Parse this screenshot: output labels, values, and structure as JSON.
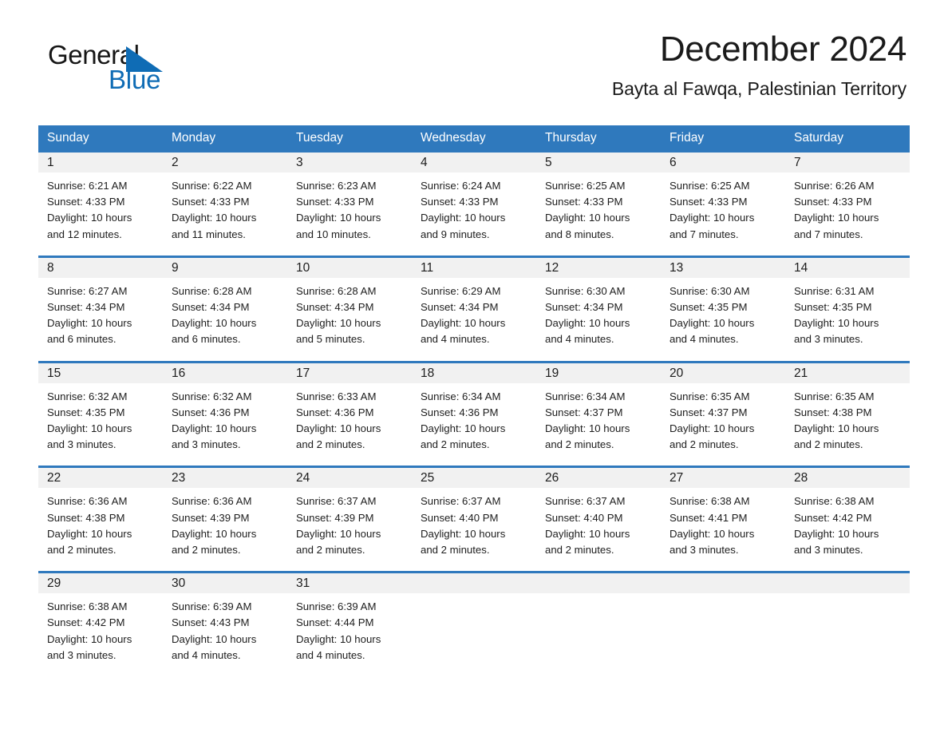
{
  "brand": {
    "name_part1": "General",
    "name_part2": "Blue",
    "logo_icon": "triangle-logo-icon",
    "color_dark": "#161616",
    "color_blue": "#0f6cb5"
  },
  "header": {
    "title": "December 2024",
    "location": "Bayta al Fawqa, Palestinian Territory"
  },
  "calendar": {
    "header_color": "#2f79bd",
    "daynum_band_color": "#f1f1f1",
    "weekdays": [
      "Sunday",
      "Monday",
      "Tuesday",
      "Wednesday",
      "Thursday",
      "Friday",
      "Saturday"
    ],
    "weeks": [
      [
        {
          "day": "1",
          "sunrise": "Sunrise: 6:21 AM",
          "sunset": "Sunset: 4:33 PM",
          "daylight_line1": "Daylight: 10 hours",
          "daylight_line2": "and 12 minutes."
        },
        {
          "day": "2",
          "sunrise": "Sunrise: 6:22 AM",
          "sunset": "Sunset: 4:33 PM",
          "daylight_line1": "Daylight: 10 hours",
          "daylight_line2": "and 11 minutes."
        },
        {
          "day": "3",
          "sunrise": "Sunrise: 6:23 AM",
          "sunset": "Sunset: 4:33 PM",
          "daylight_line1": "Daylight: 10 hours",
          "daylight_line2": "and 10 minutes."
        },
        {
          "day": "4",
          "sunrise": "Sunrise: 6:24 AM",
          "sunset": "Sunset: 4:33 PM",
          "daylight_line1": "Daylight: 10 hours",
          "daylight_line2": "and 9 minutes."
        },
        {
          "day": "5",
          "sunrise": "Sunrise: 6:25 AM",
          "sunset": "Sunset: 4:33 PM",
          "daylight_line1": "Daylight: 10 hours",
          "daylight_line2": "and 8 minutes."
        },
        {
          "day": "6",
          "sunrise": "Sunrise: 6:25 AM",
          "sunset": "Sunset: 4:33 PM",
          "daylight_line1": "Daylight: 10 hours",
          "daylight_line2": "and 7 minutes."
        },
        {
          "day": "7",
          "sunrise": "Sunrise: 6:26 AM",
          "sunset": "Sunset: 4:33 PM",
          "daylight_line1": "Daylight: 10 hours",
          "daylight_line2": "and 7 minutes."
        }
      ],
      [
        {
          "day": "8",
          "sunrise": "Sunrise: 6:27 AM",
          "sunset": "Sunset: 4:34 PM",
          "daylight_line1": "Daylight: 10 hours",
          "daylight_line2": "and 6 minutes."
        },
        {
          "day": "9",
          "sunrise": "Sunrise: 6:28 AM",
          "sunset": "Sunset: 4:34 PM",
          "daylight_line1": "Daylight: 10 hours",
          "daylight_line2": "and 6 minutes."
        },
        {
          "day": "10",
          "sunrise": "Sunrise: 6:28 AM",
          "sunset": "Sunset: 4:34 PM",
          "daylight_line1": "Daylight: 10 hours",
          "daylight_line2": "and 5 minutes."
        },
        {
          "day": "11",
          "sunrise": "Sunrise: 6:29 AM",
          "sunset": "Sunset: 4:34 PM",
          "daylight_line1": "Daylight: 10 hours",
          "daylight_line2": "and 4 minutes."
        },
        {
          "day": "12",
          "sunrise": "Sunrise: 6:30 AM",
          "sunset": "Sunset: 4:34 PM",
          "daylight_line1": "Daylight: 10 hours",
          "daylight_line2": "and 4 minutes."
        },
        {
          "day": "13",
          "sunrise": "Sunrise: 6:30 AM",
          "sunset": "Sunset: 4:35 PM",
          "daylight_line1": "Daylight: 10 hours",
          "daylight_line2": "and 4 minutes."
        },
        {
          "day": "14",
          "sunrise": "Sunrise: 6:31 AM",
          "sunset": "Sunset: 4:35 PM",
          "daylight_line1": "Daylight: 10 hours",
          "daylight_line2": "and 3 minutes."
        }
      ],
      [
        {
          "day": "15",
          "sunrise": "Sunrise: 6:32 AM",
          "sunset": "Sunset: 4:35 PM",
          "daylight_line1": "Daylight: 10 hours",
          "daylight_line2": "and 3 minutes."
        },
        {
          "day": "16",
          "sunrise": "Sunrise: 6:32 AM",
          "sunset": "Sunset: 4:36 PM",
          "daylight_line1": "Daylight: 10 hours",
          "daylight_line2": "and 3 minutes."
        },
        {
          "day": "17",
          "sunrise": "Sunrise: 6:33 AM",
          "sunset": "Sunset: 4:36 PM",
          "daylight_line1": "Daylight: 10 hours",
          "daylight_line2": "and 2 minutes."
        },
        {
          "day": "18",
          "sunrise": "Sunrise: 6:34 AM",
          "sunset": "Sunset: 4:36 PM",
          "daylight_line1": "Daylight: 10 hours",
          "daylight_line2": "and 2 minutes."
        },
        {
          "day": "19",
          "sunrise": "Sunrise: 6:34 AM",
          "sunset": "Sunset: 4:37 PM",
          "daylight_line1": "Daylight: 10 hours",
          "daylight_line2": "and 2 minutes."
        },
        {
          "day": "20",
          "sunrise": "Sunrise: 6:35 AM",
          "sunset": "Sunset: 4:37 PM",
          "daylight_line1": "Daylight: 10 hours",
          "daylight_line2": "and 2 minutes."
        },
        {
          "day": "21",
          "sunrise": "Sunrise: 6:35 AM",
          "sunset": "Sunset: 4:38 PM",
          "daylight_line1": "Daylight: 10 hours",
          "daylight_line2": "and 2 minutes."
        }
      ],
      [
        {
          "day": "22",
          "sunrise": "Sunrise: 6:36 AM",
          "sunset": "Sunset: 4:38 PM",
          "daylight_line1": "Daylight: 10 hours",
          "daylight_line2": "and 2 minutes."
        },
        {
          "day": "23",
          "sunrise": "Sunrise: 6:36 AM",
          "sunset": "Sunset: 4:39 PM",
          "daylight_line1": "Daylight: 10 hours",
          "daylight_line2": "and 2 minutes."
        },
        {
          "day": "24",
          "sunrise": "Sunrise: 6:37 AM",
          "sunset": "Sunset: 4:39 PM",
          "daylight_line1": "Daylight: 10 hours",
          "daylight_line2": "and 2 minutes."
        },
        {
          "day": "25",
          "sunrise": "Sunrise: 6:37 AM",
          "sunset": "Sunset: 4:40 PM",
          "daylight_line1": "Daylight: 10 hours",
          "daylight_line2": "and 2 minutes."
        },
        {
          "day": "26",
          "sunrise": "Sunrise: 6:37 AM",
          "sunset": "Sunset: 4:40 PM",
          "daylight_line1": "Daylight: 10 hours",
          "daylight_line2": "and 2 minutes."
        },
        {
          "day": "27",
          "sunrise": "Sunrise: 6:38 AM",
          "sunset": "Sunset: 4:41 PM",
          "daylight_line1": "Daylight: 10 hours",
          "daylight_line2": "and 3 minutes."
        },
        {
          "day": "28",
          "sunrise": "Sunrise: 6:38 AM",
          "sunset": "Sunset: 4:42 PM",
          "daylight_line1": "Daylight: 10 hours",
          "daylight_line2": "and 3 minutes."
        }
      ],
      [
        {
          "day": "29",
          "sunrise": "Sunrise: 6:38 AM",
          "sunset": "Sunset: 4:42 PM",
          "daylight_line1": "Daylight: 10 hours",
          "daylight_line2": "and 3 minutes."
        },
        {
          "day": "30",
          "sunrise": "Sunrise: 6:39 AM",
          "sunset": "Sunset: 4:43 PM",
          "daylight_line1": "Daylight: 10 hours",
          "daylight_line2": "and 4 minutes."
        },
        {
          "day": "31",
          "sunrise": "Sunrise: 6:39 AM",
          "sunset": "Sunset: 4:44 PM",
          "daylight_line1": "Daylight: 10 hours",
          "daylight_line2": "and 4 minutes."
        },
        {
          "day": "",
          "sunrise": "",
          "sunset": "",
          "daylight_line1": "",
          "daylight_line2": ""
        },
        {
          "day": "",
          "sunrise": "",
          "sunset": "",
          "daylight_line1": "",
          "daylight_line2": ""
        },
        {
          "day": "",
          "sunrise": "",
          "sunset": "",
          "daylight_line1": "",
          "daylight_line2": ""
        },
        {
          "day": "",
          "sunrise": "",
          "sunset": "",
          "daylight_line1": "",
          "daylight_line2": ""
        }
      ]
    ]
  }
}
